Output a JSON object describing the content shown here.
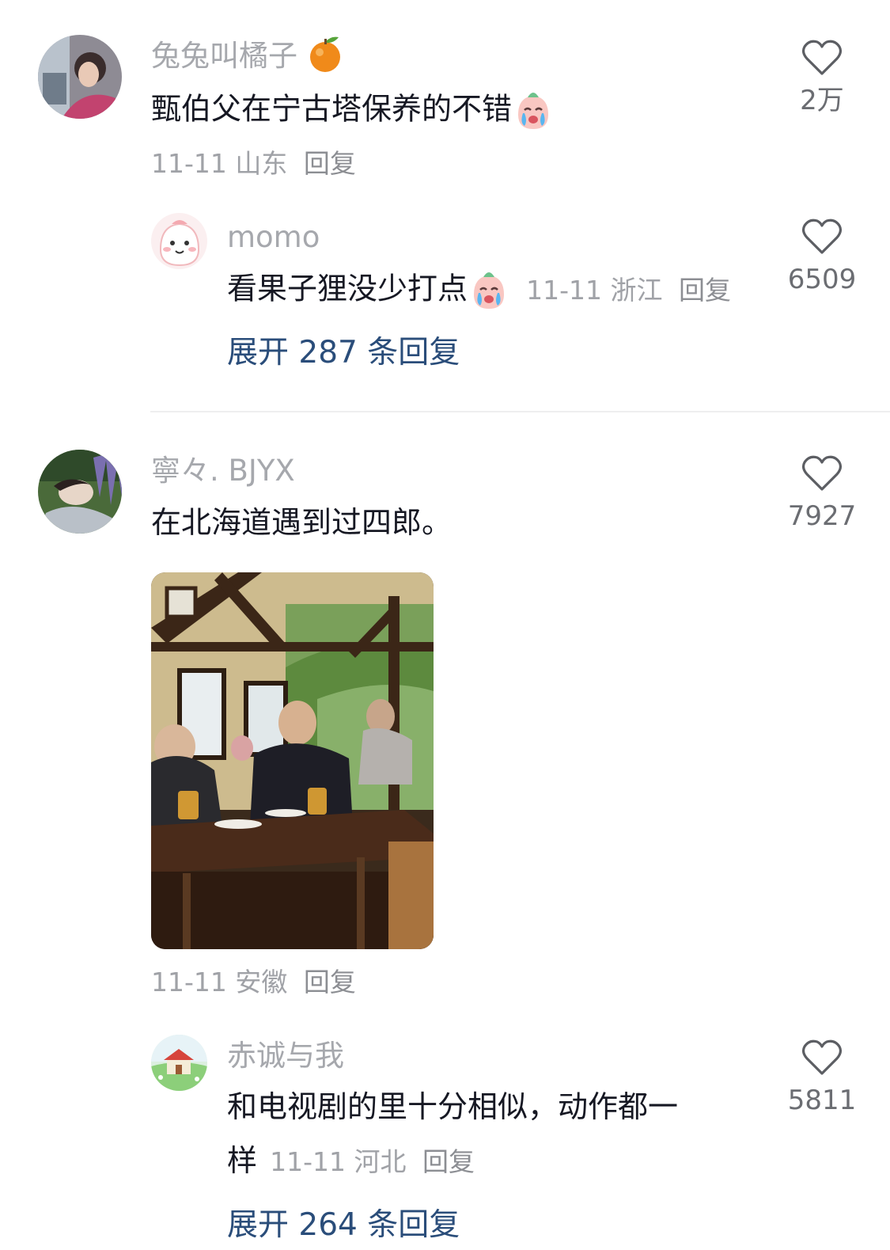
{
  "comments": [
    {
      "username": "兔兔叫橘子",
      "username_emoji": "orange-emoji",
      "text": "甄伯父在宁古塔保养的不错",
      "text_emoji": "crying-face-emoji",
      "date": "11-11",
      "location": "山东",
      "reply_label": "回复",
      "likes": "2万",
      "replies": [
        {
          "username": "momo",
          "text": "看果子狸没少打点",
          "text_emoji": "crying-face-emoji",
          "date": "11-11",
          "location": "浙江",
          "reply_label": "回复",
          "likes": "6509"
        }
      ],
      "expand_label": "展开 287 条回复"
    },
    {
      "username": "寧々. BJYX",
      "text": "在北海道遇到过四郎。",
      "has_photo": true,
      "date": "11-11",
      "location": "安徽",
      "reply_label": "回复",
      "likes": "7927",
      "replies": [
        {
          "username": "赤诚与我",
          "text_line1": "和电视剧的里十分相似，动作都一",
          "text_line2": "样",
          "date": "11-11",
          "location": "河北",
          "reply_label": "回复",
          "likes": "5811"
        }
      ],
      "expand_label": "展开 264 条回复"
    }
  ],
  "colors": {
    "username": "#a6a8ad",
    "text": "#161823",
    "meta": "#a0a2a7",
    "expand_link": "#2a4d7a",
    "divider": "#eeeeef"
  },
  "icons": {
    "like": "heart-outline-icon"
  }
}
